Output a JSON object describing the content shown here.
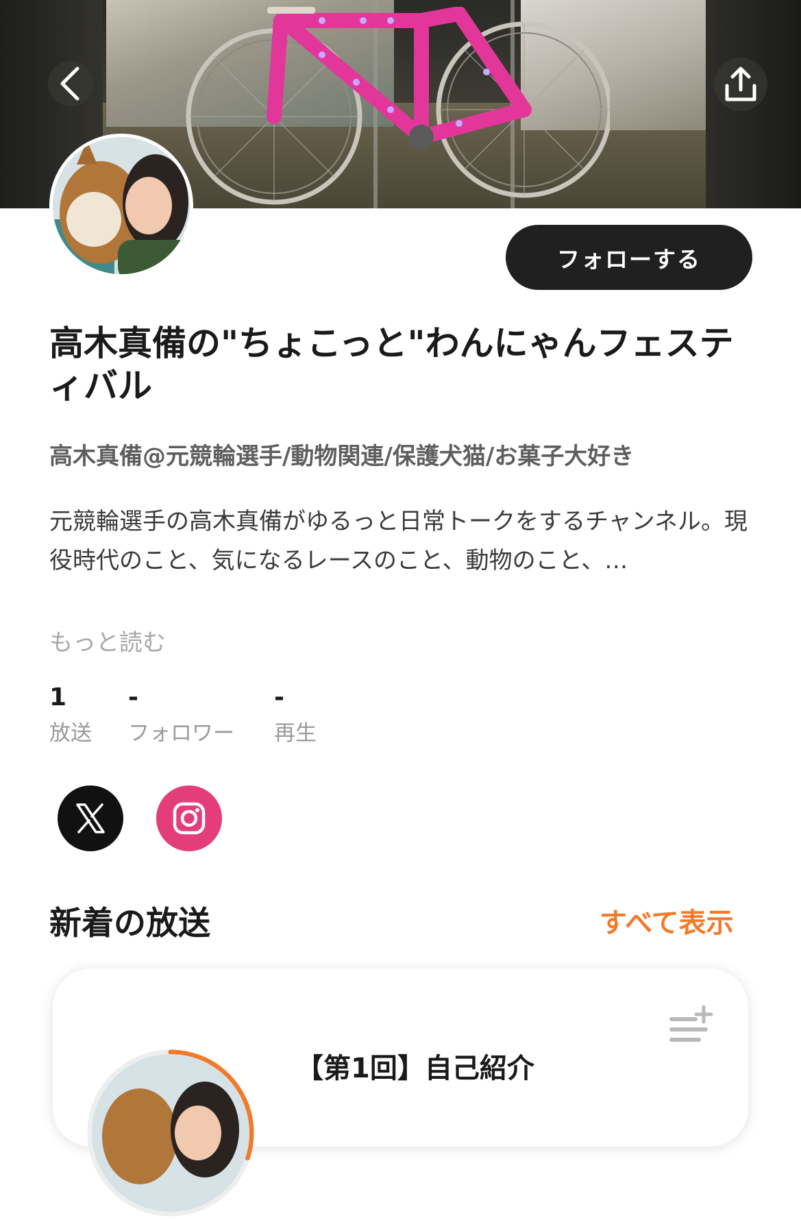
{
  "colors": {
    "accent": "#f27a2a",
    "follow_bg": "#202020",
    "x_bg": "#111111",
    "instagram_bg": "#e33d7a",
    "bike": "#e2369a"
  },
  "header": {
    "back_icon": "chevron-left-icon",
    "share_icon": "share-upload-icon",
    "banner_alt": "pink-racing-bicycle-photo"
  },
  "channel": {
    "follow_label": "フォローする",
    "title": "高木真備の\"ちょこっと\"わんにゃんフェスティバル",
    "subtitle": "高木真備@元競輪選手/動物関連/保護犬猫/お菓子大好き",
    "description": "元競輪選手の高木真備がゆるっと日常トークをするチャンネル。現役時代のこと、気になるレースのこと、動物のこと、…",
    "more_label": "もっと読む"
  },
  "stats": [
    {
      "value": "1",
      "label": "放送"
    },
    {
      "value": "-",
      "label": "フォロワー"
    },
    {
      "value": "-",
      "label": "再生"
    }
  ],
  "social": [
    {
      "icon": "x-logo-icon"
    },
    {
      "icon": "instagram-icon"
    }
  ],
  "section": {
    "title": "新着の放送",
    "see_all": "すべて表示"
  },
  "episode": {
    "title": "【第1回】自己紹介",
    "add_icon": "add-to-playlist-icon",
    "progress": 0.3
  }
}
